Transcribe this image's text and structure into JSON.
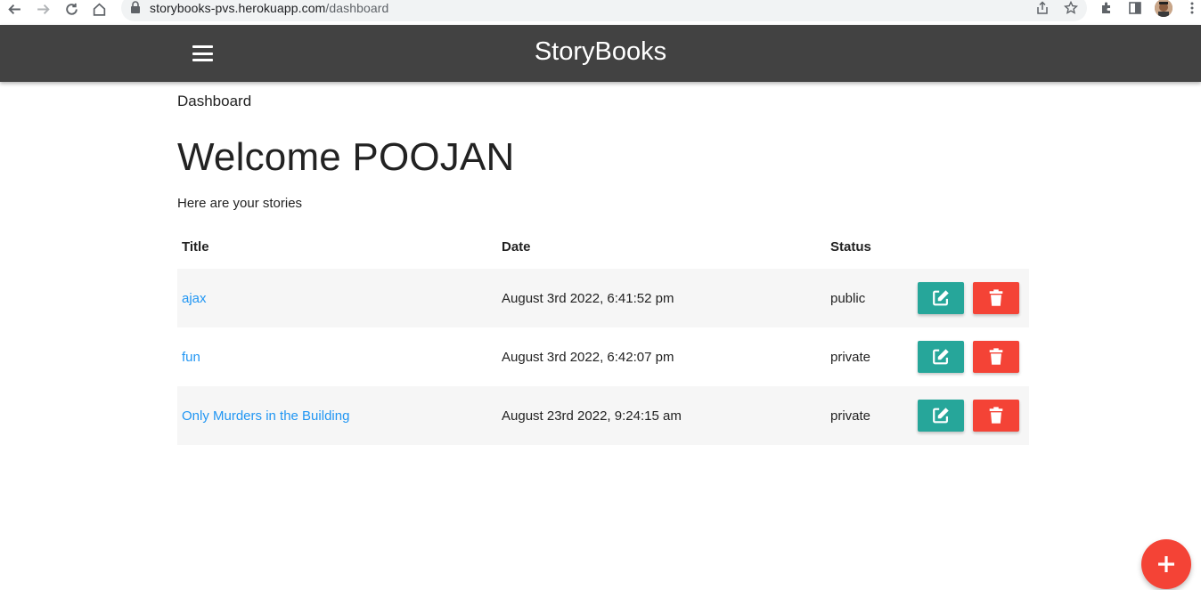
{
  "browser": {
    "url_host": "storybooks-pvs.herokuapp.com",
    "url_path": "/dashboard"
  },
  "navbar": {
    "brand": "StoryBooks"
  },
  "page": {
    "breadcrumb": "Dashboard",
    "welcome": "Welcome POOJAN",
    "subtitle": "Here are your stories"
  },
  "table": {
    "headers": [
      "Title",
      "Date",
      "Status",
      ""
    ],
    "rows": [
      {
        "title": "ajax",
        "date": "August 3rd 2022, 6:41:52 pm",
        "status": "public"
      },
      {
        "title": "fun",
        "date": "August 3rd 2022, 6:42:07 pm",
        "status": "private"
      },
      {
        "title": "Only Murders in the Building",
        "date": "August 23rd 2022, 9:24:15 am",
        "status": "private"
      }
    ]
  },
  "colors": {
    "navbar": "#424242",
    "edit": "#26a69a",
    "delete": "#f44336",
    "link": "#2196f3"
  },
  "icons": {
    "menu": "hamburger-icon",
    "edit": "edit-icon",
    "delete": "trash-icon",
    "add": "plus-icon"
  }
}
